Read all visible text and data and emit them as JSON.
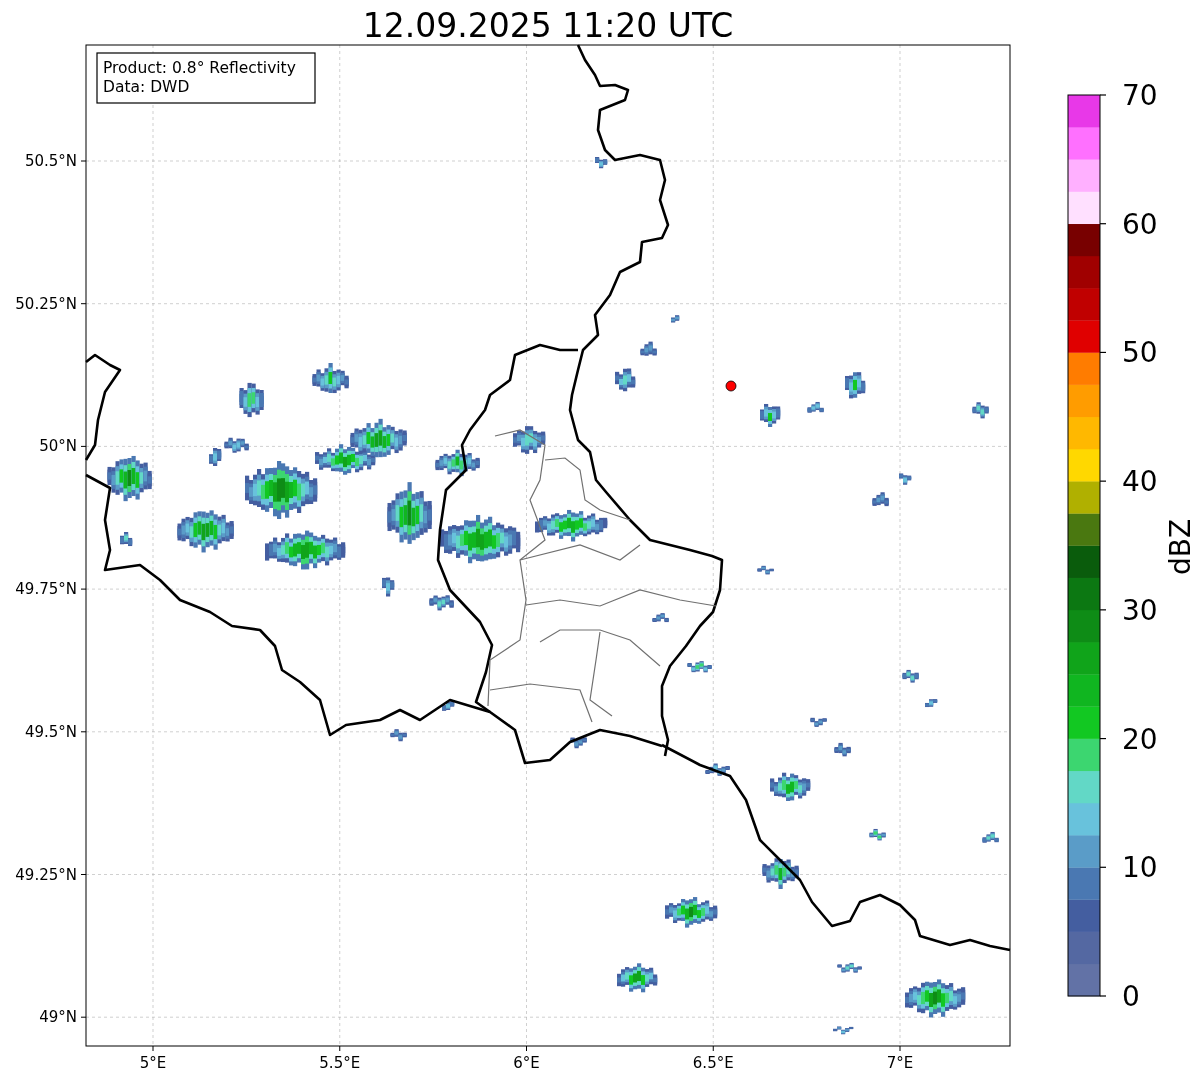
{
  "title": "12.09.2025 11:20 UTC",
  "legend": [
    "Product: 0.8° Reflectivity",
    "Data: DWD"
  ],
  "map": {
    "x_ticks": [
      "5°E",
      "5.5°E",
      "6°E",
      "6.5°E",
      "7°E"
    ],
    "y_ticks": [
      "50.5°N",
      "50.25°N",
      "50°N",
      "49.75°N",
      "49.5°N",
      "49.25°N",
      "49°N"
    ]
  },
  "colorbar": {
    "label": "dBZ",
    "ticks": [
      "70",
      "60",
      "50",
      "40",
      "30",
      "20",
      "10",
      "0"
    ],
    "bins": [
      {
        "color": "#6272a6"
      },
      {
        "color": "#5468a2"
      },
      {
        "color": "#445ea0"
      },
      {
        "color": "#4a78b2"
      },
      {
        "color": "#5a9cc8"
      },
      {
        "color": "#68c2dc"
      },
      {
        "color": "#62d8c6"
      },
      {
        "color": "#3cd670"
      },
      {
        "color": "#12c822"
      },
      {
        "color": "#10b620"
      },
      {
        "color": "#10a41a"
      },
      {
        "color": "#0e8c16"
      },
      {
        "color": "#0c7812"
      },
      {
        "color": "#0a5c0c"
      },
      {
        "color": "#4a7810"
      },
      {
        "color": "#b0b000"
      },
      {
        "color": "#ffd800"
      },
      {
        "color": "#ffb800"
      },
      {
        "color": "#ff9c00"
      },
      {
        "color": "#ff7c00"
      },
      {
        "color": "#e00000"
      },
      {
        "color": "#c00000"
      },
      {
        "color": "#a00000"
      },
      {
        "color": "#780000"
      },
      {
        "color": "#ffe0ff"
      },
      {
        "color": "#ffb0ff"
      },
      {
        "color": "#ff70ff"
      },
      {
        "color": "#e838e8"
      }
    ]
  }
}
